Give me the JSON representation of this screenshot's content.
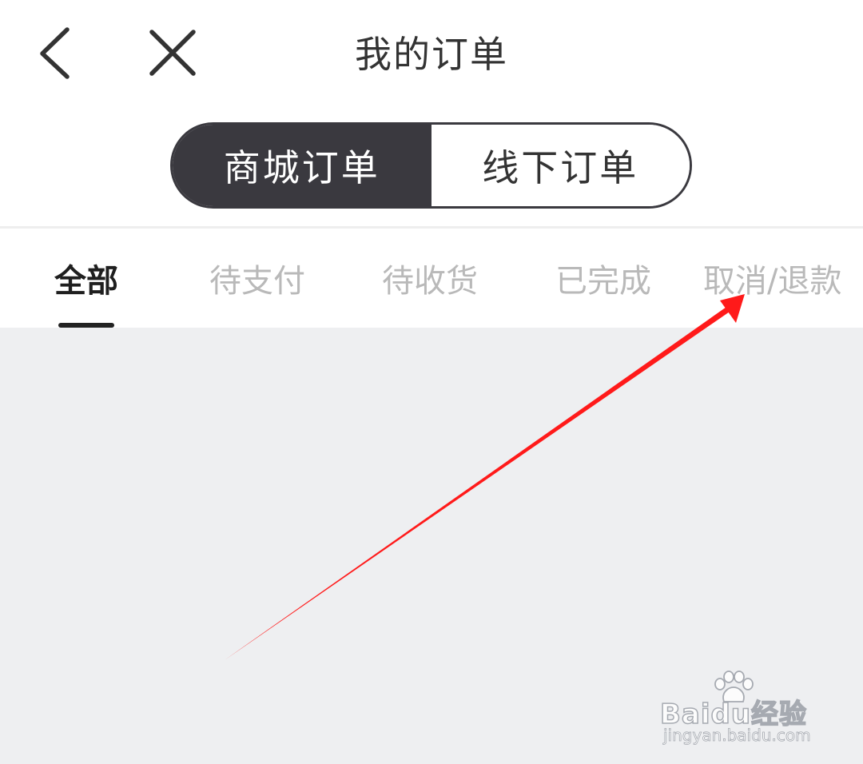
{
  "header": {
    "title": "我的订单",
    "back_icon": "chevron-left-icon",
    "close_icon": "close-icon"
  },
  "segment": {
    "items": [
      {
        "label": "商城订单",
        "active": true
      },
      {
        "label": "线下订单",
        "active": false
      }
    ]
  },
  "tabs": {
    "items": [
      {
        "label": "全部",
        "active": true
      },
      {
        "label": "待支付",
        "active": false
      },
      {
        "label": "待收货",
        "active": false
      },
      {
        "label": "已完成",
        "active": false
      },
      {
        "label": "取消/退款",
        "active": false
      }
    ]
  },
  "annotation": {
    "color": "#ff1a1a",
    "points_to": "取消/退款"
  },
  "watermark": {
    "main": "Baidu经验",
    "sub": "jingyan.baidu.com"
  },
  "colors": {
    "segment_active_bg": "#3a393f",
    "content_bg": "#eeeff1",
    "tab_inactive": "#b9b9b9",
    "tab_active": "#1f1f1f"
  }
}
